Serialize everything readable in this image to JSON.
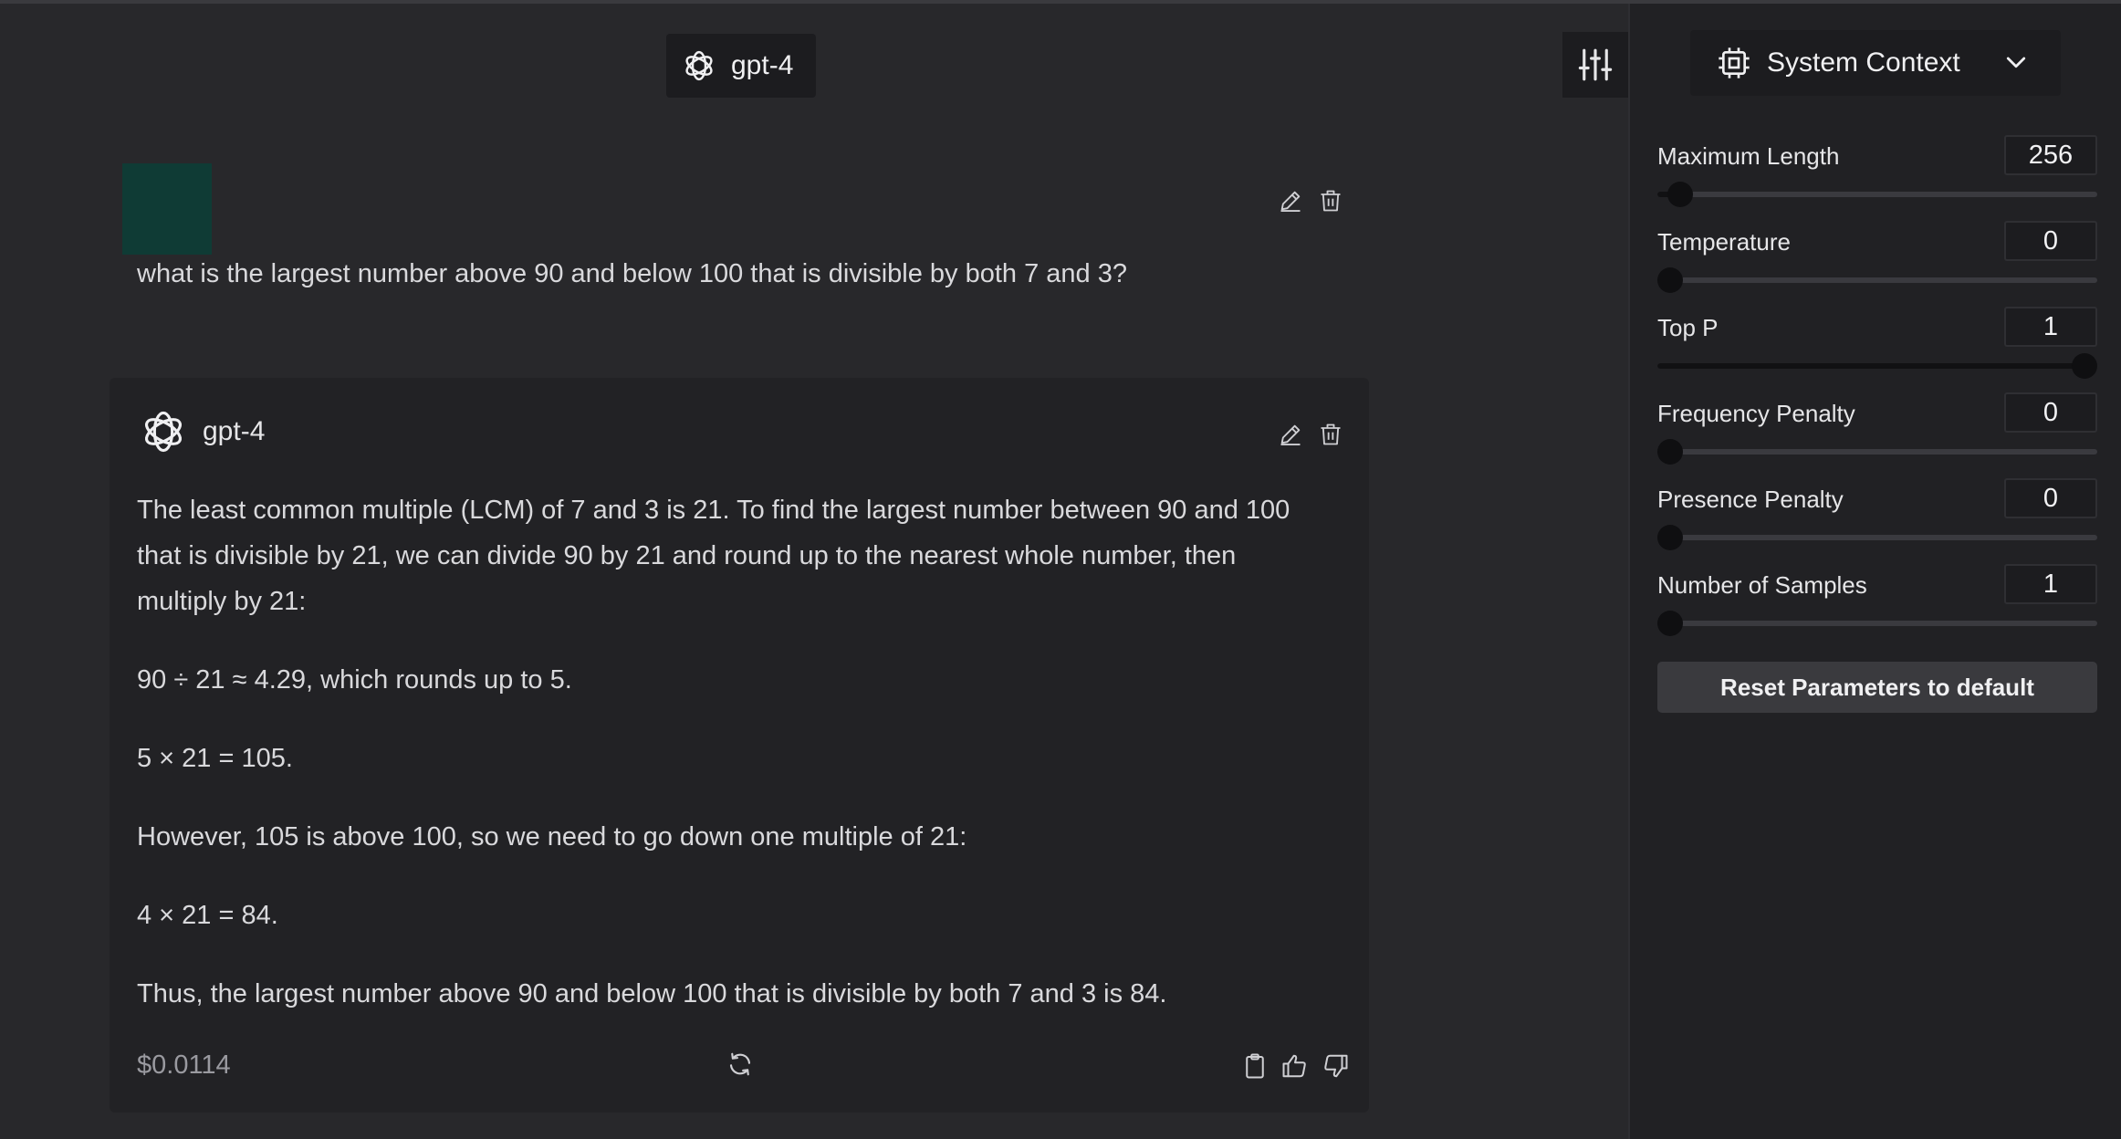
{
  "header": {
    "model_name": "gpt-4"
  },
  "user_message": {
    "text": "what is the largest number above 90 and below 100 that is divisible by both 7 and 3?"
  },
  "assistant_message": {
    "model_name": "gpt-4",
    "paragraphs": [
      "The least common multiple (LCM) of 7 and 3 is 21. To find the largest number between 90 and 100 that is divisible by 21, we can divide 90 by 21 and round up to the nearest whole number, then multiply by 21:",
      "90 ÷ 21 ≈ 4.29, which rounds up to 5.",
      "5 × 21 = 105.",
      "However, 105 is above 100, so we need to go down one multiple of 21:",
      "4 × 21 = 84.",
      "Thus, the largest number above 90 and below 100 that is divisible by both 7 and 3 is 84."
    ],
    "cost": "$0.0114"
  },
  "sidebar": {
    "system_context_label": "System Context",
    "params": [
      {
        "label": "Maximum Length",
        "value": "256",
        "fraction": 0.025
      },
      {
        "label": "Temperature",
        "value": "0",
        "fraction": 0.0
      },
      {
        "label": "Top P",
        "value": "1",
        "fraction": 1.0
      },
      {
        "label": "Frequency Penalty",
        "value": "0",
        "fraction": 0.0
      },
      {
        "label": "Presence Penalty",
        "value": "0",
        "fraction": 0.0
      },
      {
        "label": "Number of Samples",
        "value": "1",
        "fraction": 0.0
      }
    ],
    "reset_label": "Reset Parameters to default"
  },
  "colors": {
    "background": "#28282b",
    "sidebar_background": "#212124",
    "assistant_card": "#222225",
    "avatar": "#0f3b35"
  }
}
